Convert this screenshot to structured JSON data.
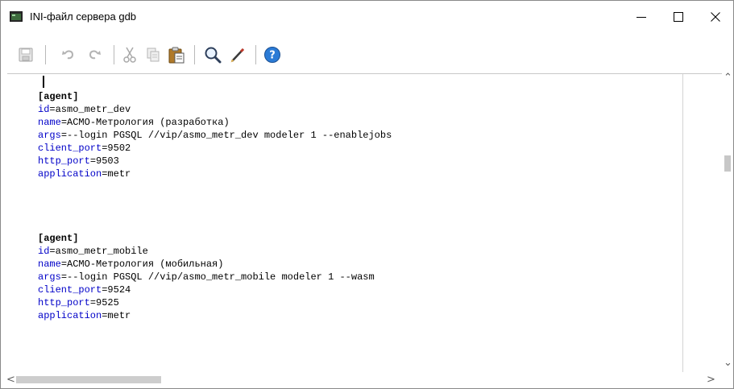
{
  "window": {
    "title": "INI-файл сервера gdb",
    "minimize_label": "—",
    "maximize_label": "☐",
    "close_label": "✕"
  },
  "toolbar": {
    "buttons": [
      {
        "name": "save-icon",
        "enabled": false
      },
      {
        "name": "undo-icon",
        "enabled": false
      },
      {
        "name": "redo-icon",
        "enabled": false
      },
      {
        "name": "cut-icon",
        "enabled": false
      },
      {
        "name": "copy-icon",
        "enabled": false
      },
      {
        "name": "paste-icon",
        "enabled": true
      },
      {
        "name": "find-icon",
        "enabled": true
      },
      {
        "name": "edit-pencil-icon",
        "enabled": true
      },
      {
        "name": "help-icon",
        "enabled": true
      }
    ]
  },
  "editor": {
    "lines": [
      {
        "text": ""
      },
      {
        "section": "[agent]"
      },
      {
        "key": "id",
        "value": "asmo_metr_dev"
      },
      {
        "key": "name",
        "value": "АСМО-Метрология (разработка)"
      },
      {
        "key": "args",
        "value": "--login PGSQL //vip/asmo_metr_dev modeler 1 --enablejobs"
      },
      {
        "key": "client_port",
        "value": "9502"
      },
      {
        "key": "http_port",
        "value": "9503"
      },
      {
        "key": "application",
        "value": "metr"
      },
      {
        "text": ""
      },
      {
        "text": ""
      },
      {
        "text": ""
      },
      {
        "text": ""
      },
      {
        "section": "[agent]"
      },
      {
        "key": "id",
        "value": "asmo_metr_mobile"
      },
      {
        "key": "name",
        "value": "АСМО-Метрология (мобильная)"
      },
      {
        "key": "args",
        "value": "--login PGSQL //vip/asmo_metr_mobile modeler 1 --wasm"
      },
      {
        "key": "client_port",
        "value": "9524"
      },
      {
        "key": "http_port",
        "value": "9525"
      },
      {
        "key": "application",
        "value": "metr"
      }
    ]
  },
  "scroll": {
    "up_arrow": "⌃",
    "down_arrow": "⌄",
    "left_arrow": "<",
    "right_arrow": ">"
  }
}
